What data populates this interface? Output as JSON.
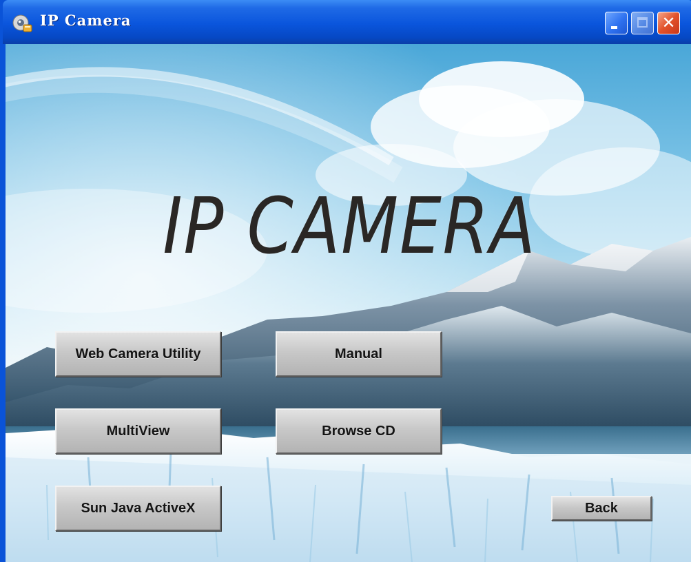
{
  "window": {
    "title": "IP Camera",
    "controls": {
      "minimize_icon": "minimize-icon",
      "maximize_icon": "maximize-icon",
      "close_icon": "close-icon",
      "close_glyph": "✕"
    }
  },
  "content": {
    "logo_text": "IP CAMERA",
    "buttons": {
      "web_camera_utility": "Web Camera Utility",
      "manual": "Manual",
      "multiview": "MultiView",
      "browse_cd": "Browse CD",
      "sun_java_activex": "Sun Java ActiveX",
      "back": "Back"
    }
  },
  "colors": {
    "titlebar_blue": "#0a55dc",
    "button_gray": "#c8c8c8",
    "logo_text": "#2a2725"
  }
}
